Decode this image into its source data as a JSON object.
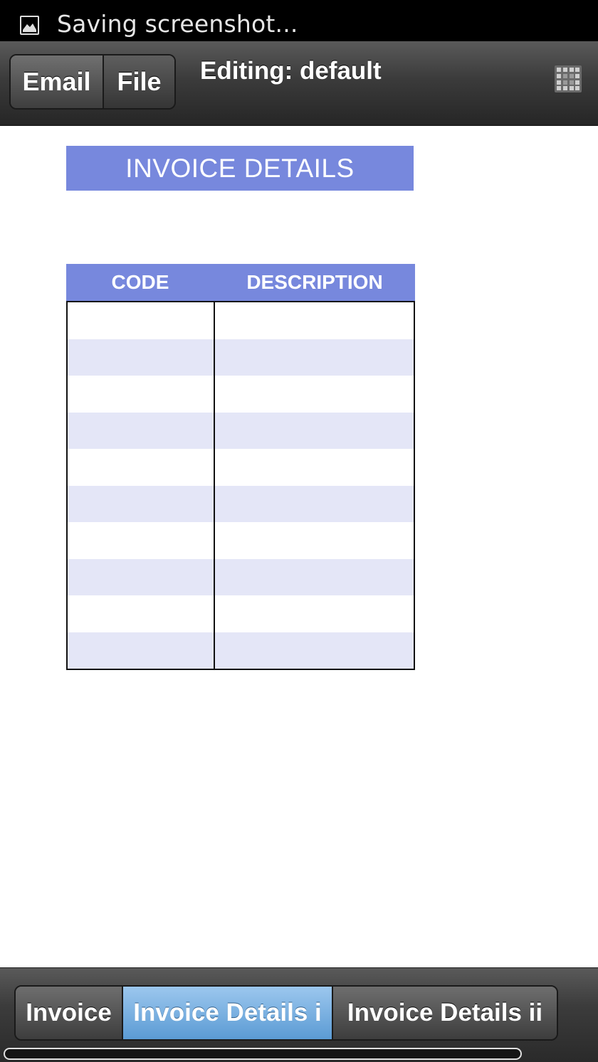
{
  "status_bar": {
    "icon": "image-icon",
    "text": "Saving screenshot..."
  },
  "topbar": {
    "email_label": "Email",
    "file_label": "File",
    "title": "Editing: default",
    "right_icon": "grid-icon"
  },
  "invoice": {
    "header": "INVOICE DETAILS",
    "columns": [
      "CODE",
      "DESCRIPTION"
    ],
    "rows": [
      [
        "",
        ""
      ],
      [
        "",
        ""
      ],
      [
        "",
        ""
      ],
      [
        "",
        ""
      ],
      [
        "",
        ""
      ],
      [
        "",
        ""
      ],
      [
        "",
        ""
      ],
      [
        "",
        ""
      ],
      [
        "",
        ""
      ],
      [
        "",
        ""
      ]
    ]
  },
  "tabs": {
    "items": [
      "Invoice",
      "Invoice Details i",
      "Invoice Details ii"
    ],
    "selected": "Invoice Details i"
  },
  "colors": {
    "accent": "#7788dd",
    "row_alt": "#e4e6f7",
    "tab_selected": "#5b9bd4"
  }
}
